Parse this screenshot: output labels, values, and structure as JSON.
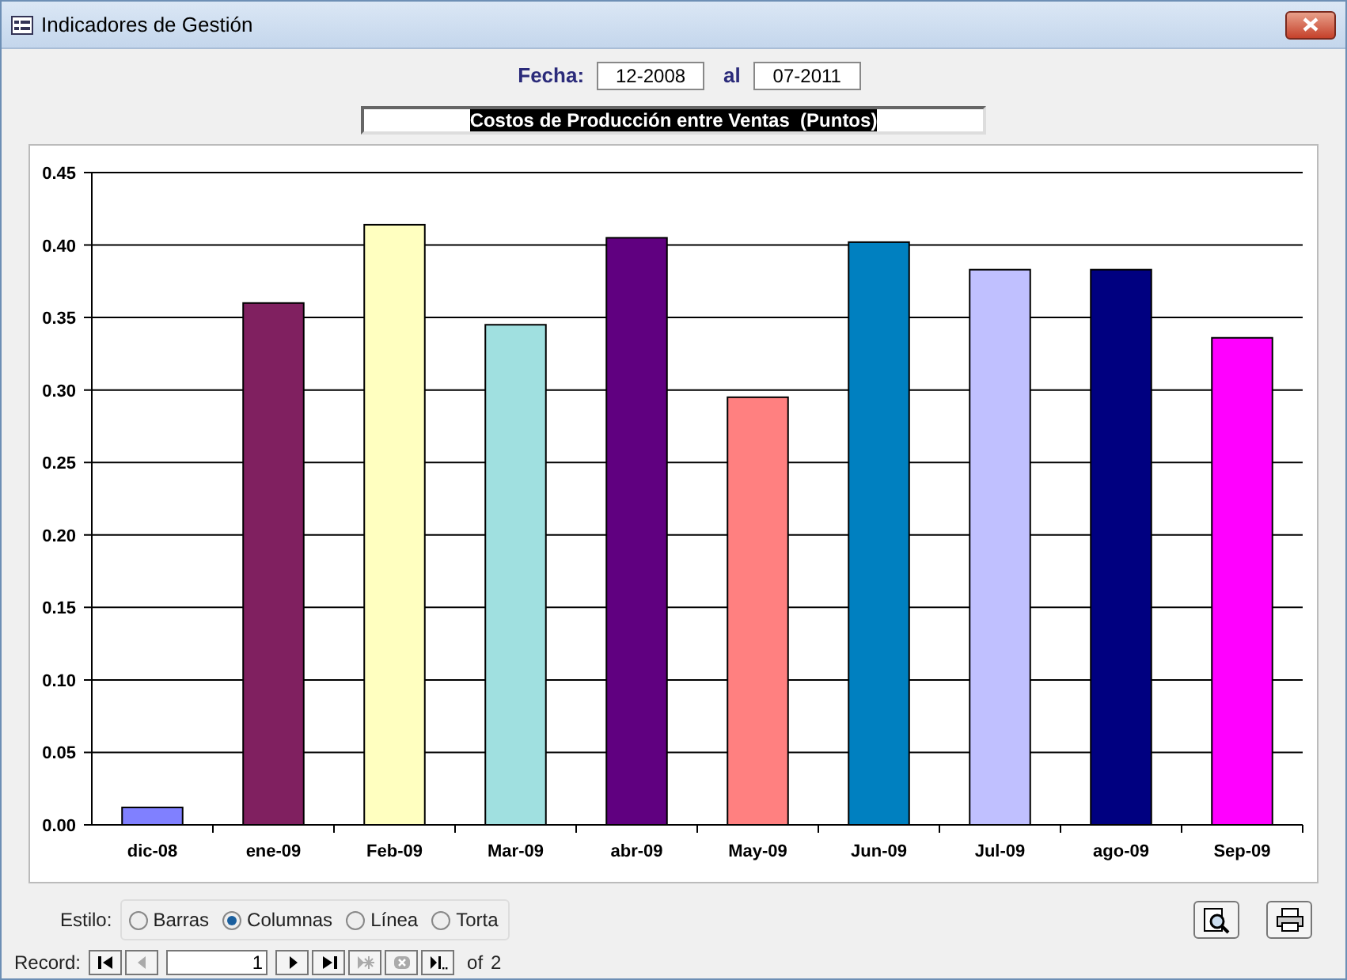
{
  "window": {
    "title": "Indicadores de Gestión"
  },
  "filter": {
    "from_label": "Fecha:",
    "from_value": "12-2008",
    "to_label": "al",
    "to_value": "07-2011"
  },
  "chart_title": "Costos de Producción entre Ventas  (Puntos)",
  "chart_data": {
    "type": "bar",
    "orientation": "vertical",
    "categories": [
      "dic-08",
      "ene-09",
      "Feb-09",
      "Mar-09",
      "abr-09",
      "May-09",
      "Jun-09",
      "Jul-09",
      "ago-09",
      "Sep-09"
    ],
    "grid": true,
    "series": [
      {
        "values": [
          0.012,
          0.36,
          0.414,
          0.345,
          0.405,
          0.295,
          0.402,
          0.383,
          0.383,
          0.336
        ]
      }
    ],
    "colors": [
      "#8080ff",
      "#802060",
      "#ffffc0",
      "#a0e0e0",
      "#600080",
      "#ff8080",
      "#0080c0",
      "#c0c0ff",
      "#000080",
      "#ff00ff"
    ],
    "ylim": [
      0,
      0.45
    ],
    "yticks": [
      {
        "value": 0,
        "label": "0.00"
      },
      {
        "value": 0.05,
        "label": "0.05"
      },
      {
        "value": 0.1,
        "label": "0.10"
      },
      {
        "value": 0.15,
        "label": "0.15"
      },
      {
        "value": 0.2,
        "label": "0.20"
      },
      {
        "value": 0.25,
        "label": "0.25"
      },
      {
        "value": 0.3,
        "label": "0.30"
      },
      {
        "value": 0.35,
        "label": "0.35"
      },
      {
        "value": 0.4,
        "label": "0.40"
      },
      {
        "value": 0.45,
        "label": "0.45"
      }
    ]
  },
  "style": {
    "label": "Estilo:",
    "options": [
      {
        "label": "Barras",
        "selected": false
      },
      {
        "label": "Columnas",
        "selected": true
      },
      {
        "label": "Línea",
        "selected": false
      },
      {
        "label": "Torta",
        "selected": false
      }
    ]
  },
  "record_nav": {
    "label": "Record:",
    "current": "1",
    "of_label": "of",
    "total": "2",
    "prev_disabled": true,
    "new_disabled": true,
    "delete_disabled": true
  }
}
